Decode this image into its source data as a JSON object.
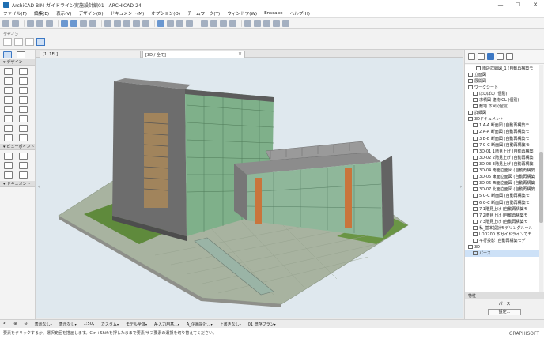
{
  "window": {
    "title": "ArchiCAD BIM ガイドライン実施設計編01 - ARCHICAD-24",
    "controls": [
      "—",
      "☐",
      "✕"
    ]
  },
  "menu": [
    "ファイル(F)",
    "編集(E)",
    "表示(V)",
    "デザイン(D)",
    "ドキュメント(M)",
    "オプション(O)",
    "チームワーク(T)",
    "ウィンドウ(W)",
    "Enscape",
    "ヘルプ(H)"
  ],
  "infobox": {
    "label": "デザイン"
  },
  "left_panel": {
    "sections": [
      "デザイン",
      "ビューポイント",
      "ドキュメント"
    ]
  },
  "tabs": [
    {
      "label": "[1. 1FL]",
      "active": false
    },
    {
      "label": "[3D / 全て]",
      "active": true
    }
  ],
  "navigator": {
    "rows": [
      {
        "label": "階段詳細図_1 (自動再構築モ",
        "indent": 3
      },
      {
        "label": "立面図",
        "indent": 1
      },
      {
        "label": "展開図",
        "indent": 1
      },
      {
        "label": "ワークシート",
        "indent": 1
      },
      {
        "label": "ほのぼの (個別)",
        "indent": 2
      },
      {
        "label": "求積図 建物 GL (個別)",
        "indent": 2
      },
      {
        "label": "敷地 下図 (個別)",
        "indent": 2
      },
      {
        "label": "詳細図",
        "indent": 1
      },
      {
        "label": "3Dドキュメント",
        "indent": 1
      },
      {
        "label": "1 A-A 断面図 (自動再構築モ",
        "indent": 2
      },
      {
        "label": "2 A-A 断面図 (自動再構築モ",
        "indent": 2
      },
      {
        "label": "3 B-B 断面図 (自動再構築モ",
        "indent": 2
      },
      {
        "label": "7 C-C 断面図 (自動再構築モ",
        "indent": 2
      },
      {
        "label": "3D-01 1階見上げ (自動再構築",
        "indent": 2
      },
      {
        "label": "3D-02 2階見上げ (自動再構築",
        "indent": 2
      },
      {
        "label": "3D-03 3階見上げ (自動再構築",
        "indent": 2
      },
      {
        "label": "3D-04 南面立面図 (自動再構築",
        "indent": 2
      },
      {
        "label": "3D-05 東面立面図 (自動再構築",
        "indent": 2
      },
      {
        "label": "3D-06 西面立面図 (自動再構築",
        "indent": 2
      },
      {
        "label": "3D-07 北面立面図 (自動再構築",
        "indent": 2
      },
      {
        "label": "5 C-C 断面図 (自動再構築モ",
        "indent": 2
      },
      {
        "label": "6 C-C 断面図 (自動再構築モ",
        "indent": 2
      },
      {
        "label": "7 1階見上げ (自動再構築モ",
        "indent": 2
      },
      {
        "label": "7 2階見上げ (自動再構築モ",
        "indent": 2
      },
      {
        "label": "7 3階見上げ (自動再構築モ",
        "indent": 2
      },
      {
        "label": "私_基本設計モデリングルール",
        "indent": 2
      },
      {
        "label": "LOD200 本ガイドラインでモ",
        "indent": 2
      },
      {
        "label": "平行投影 (自動再構築モデ",
        "indent": 2
      },
      {
        "label": "3D",
        "indent": 1
      },
      {
        "label": "パース",
        "indent": 2,
        "selected": true
      }
    ]
  },
  "properties": {
    "header": "特性",
    "name": "パース",
    "settings_button": "設定..."
  },
  "statusbar": {
    "items": [
      "表示なし",
      "表示なし",
      "1:50",
      "カスタム",
      "モデル全体",
      "A-入力用基...",
      "A_企画設計...",
      "上書きなし",
      "01 既存プラン"
    ]
  },
  "hint": "要素をクリックするか、選択範囲を描画します。Ctrl+Shiftを押したままで要素/サブ要素の選択を切り替えてください。",
  "logo": "GRAPHISOFT",
  "colors": {
    "accent": "#3c78c4",
    "viewport_bg": "#dfe8ee",
    "glass": "#7fb08a",
    "concrete": "#6d6d6d",
    "accent_panel": "#c9753c"
  }
}
